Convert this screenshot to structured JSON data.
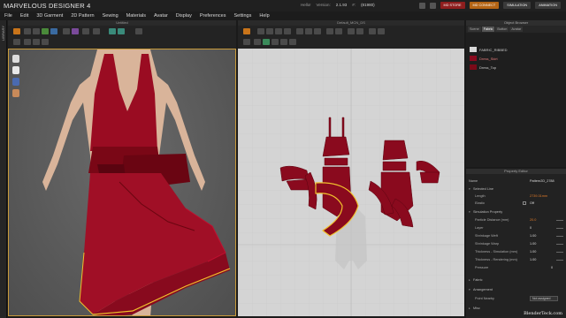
{
  "app": {
    "title": "MARVELOUS DESIGNER 4"
  },
  "titlebar": {
    "user": "Hello!",
    "version_label": "Version:",
    "version": "2.1.93",
    "build_label": "#:",
    "build": "(81980)",
    "buttons": [
      {
        "label": "MD STORE",
        "color": "#8e1e1e"
      },
      {
        "label": "MD CONNECT",
        "color": "#b46414"
      },
      {
        "label": "SIMULATION",
        "color": "#3a3a3a"
      },
      {
        "label": "ANIMATION",
        "color": "#3a3a3a"
      }
    ]
  },
  "menu": [
    "File",
    "Edit",
    "3D Garment",
    "2D Pattern",
    "Sewing",
    "Materials",
    "Avatar",
    "Display",
    "Preferences",
    "Settings",
    "Help"
  ],
  "library": {
    "label": "LIBRARY"
  },
  "panel3d": {
    "header": "Untitled"
  },
  "panel2d": {
    "header": "Default_MCN_DS"
  },
  "object_browser": {
    "title": "Object Browser",
    "tabs": [
      {
        "label": "Scene",
        "active": false
      },
      {
        "label": "Fabric",
        "active": true
      },
      {
        "label": "Button",
        "active": false
      },
      {
        "label": "Avatar",
        "active": false
      }
    ],
    "items": [
      {
        "label": "FABRIC_RIBBED",
        "color": "#d8d8d8"
      },
      {
        "label": "Dress_Skirt",
        "color": "#8a0a1e"
      },
      {
        "label": "Dress_Top",
        "color": "#7a0a18"
      }
    ]
  },
  "property_editor": {
    "title": "Property Editor",
    "name_label": "Name",
    "name_value": "Pattern2D_2788",
    "selected_line": "Selected Line",
    "length_label": "Length",
    "length_value": "2739.31mm",
    "elastic_label": "Elastic",
    "elastic_value": "Off",
    "sim_property": "Simulation Property",
    "particle_label": "Particle Distance (mm)",
    "particle_value": "20.0",
    "layer_label": "Layer",
    "layer_value": "0",
    "shrink_weft_label": "Shrinkage Weft",
    "shrink_weft_value": "1.00",
    "shrink_warp_label": "Shrinkage Warp",
    "shrink_warp_value": "1.00",
    "thick_sim_label": "Thickness - Simulation (mm)",
    "thick_sim_value": "1.00",
    "thick_render_label": "Thickness - Rendering (mm)",
    "thick_render_value": "1.00",
    "pressure_label": "Pressure",
    "pressure_value": "0",
    "fabric_label": "Fabric",
    "arrangement_label": "Arrangement",
    "point_nearby_label": "Point Nearby",
    "point_nearby_value": "Not assigned",
    "misc_label": "Misc"
  },
  "watermark": "BlenderTeck.com"
}
